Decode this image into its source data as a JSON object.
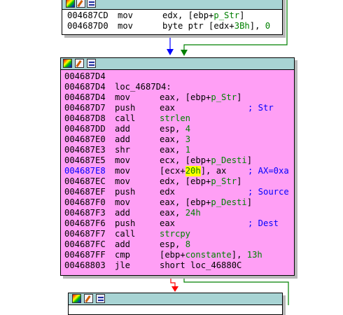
{
  "colors": {
    "node_bg": "#ffffff",
    "selected_node_bg": "#ff9ff5",
    "titlebar": "#a8d4d4",
    "symbol": "#008000",
    "comment": "#0000ff",
    "current_address": "#0000ff",
    "highlight": "#ffff00",
    "edge_blue": "#0000ff",
    "edge_green": "#008000",
    "edge_red": "#ff0000"
  },
  "titlebar_icons": [
    "graph-color-icon",
    "edit-comment-icon",
    "asm-lines-icon"
  ],
  "top_block": {
    "lines": [
      {
        "addr": "004687CD",
        "mn": "mov",
        "op": [
          {
            "t": "edx, [ebp+"
          },
          {
            "t": "p_Str",
            "c": "sym"
          },
          {
            "t": "]"
          }
        ]
      },
      {
        "addr": "004687D0",
        "mn": "mov",
        "op": [
          {
            "t": "byte ptr [edx+"
          },
          {
            "t": "3Bh",
            "c": "num"
          },
          {
            "t": "], "
          },
          {
            "t": "0",
            "c": "num"
          }
        ]
      }
    ]
  },
  "main_block": {
    "lines": [
      {
        "addr": "004687D4",
        "mn": "",
        "op": []
      },
      {
        "addr": "004687D4",
        "mn": "loc_4687D4:",
        "op": []
      },
      {
        "addr": "004687D4",
        "mn": "mov",
        "op": [
          {
            "t": "eax, [ebp+"
          },
          {
            "t": "p_Str",
            "c": "sym"
          },
          {
            "t": "]"
          }
        ]
      },
      {
        "addr": "004687D7",
        "mn": "push",
        "op": [
          {
            "t": "eax"
          }
        ],
        "cmt": "; Str"
      },
      {
        "addr": "004687D8",
        "mn": "call",
        "op": [
          {
            "t": "strlen",
            "c": "sym"
          }
        ]
      },
      {
        "addr": "004687DD",
        "mn": "add",
        "op": [
          {
            "t": "esp, "
          },
          {
            "t": "4",
            "c": "num"
          }
        ]
      },
      {
        "addr": "004687E0",
        "mn": "add",
        "op": [
          {
            "t": "eax, "
          },
          {
            "t": "3",
            "c": "num"
          }
        ]
      },
      {
        "addr": "004687E3",
        "mn": "shr",
        "op": [
          {
            "t": "eax, "
          },
          {
            "t": "1",
            "c": "num"
          }
        ]
      },
      {
        "addr": "004687E5",
        "mn": "mov",
        "op": [
          {
            "t": "ecx, [ebp+"
          },
          {
            "t": "p_Desti",
            "c": "sym"
          },
          {
            "t": "]"
          }
        ]
      },
      {
        "addr": "004687E8",
        "cur": true,
        "mn": "mov",
        "op": [
          {
            "t": "[ecx+"
          },
          {
            "t": "20h",
            "c": "hl"
          },
          {
            "t": "], ax"
          }
        ],
        "cmt": "; AX=0xa"
      },
      {
        "addr": "004687EC",
        "mn": "mov",
        "op": [
          {
            "t": "edx, [ebp+"
          },
          {
            "t": "p_Str",
            "c": "sym"
          },
          {
            "t": "]"
          }
        ]
      },
      {
        "addr": "004687EF",
        "mn": "push",
        "op": [
          {
            "t": "edx"
          }
        ],
        "cmt": "; Source"
      },
      {
        "addr": "004687F0",
        "mn": "mov",
        "op": [
          {
            "t": "eax, [ebp+"
          },
          {
            "t": "p_Desti",
            "c": "sym"
          },
          {
            "t": "]"
          }
        ]
      },
      {
        "addr": "004687F3",
        "mn": "add",
        "op": [
          {
            "t": "eax, "
          },
          {
            "t": "24h",
            "c": "num"
          }
        ]
      },
      {
        "addr": "004687F6",
        "mn": "push",
        "op": [
          {
            "t": "eax"
          }
        ],
        "cmt": "; Dest"
      },
      {
        "addr": "004687F7",
        "mn": "call",
        "op": [
          {
            "t": "strcpy",
            "c": "sym"
          }
        ]
      },
      {
        "addr": "004687FC",
        "mn": "add",
        "op": [
          {
            "t": "esp, "
          },
          {
            "t": "8",
            "c": "num"
          }
        ]
      },
      {
        "addr": "004687FF",
        "mn": "cmp",
        "op": [
          {
            "t": "[ebp+"
          },
          {
            "t": "constante",
            "c": "sym"
          },
          {
            "t": "], "
          },
          {
            "t": "13h",
            "c": "num"
          }
        ]
      },
      {
        "addr": "00468803",
        "mn": "jle",
        "op": [
          {
            "t": "short loc_46880C"
          }
        ]
      }
    ]
  }
}
